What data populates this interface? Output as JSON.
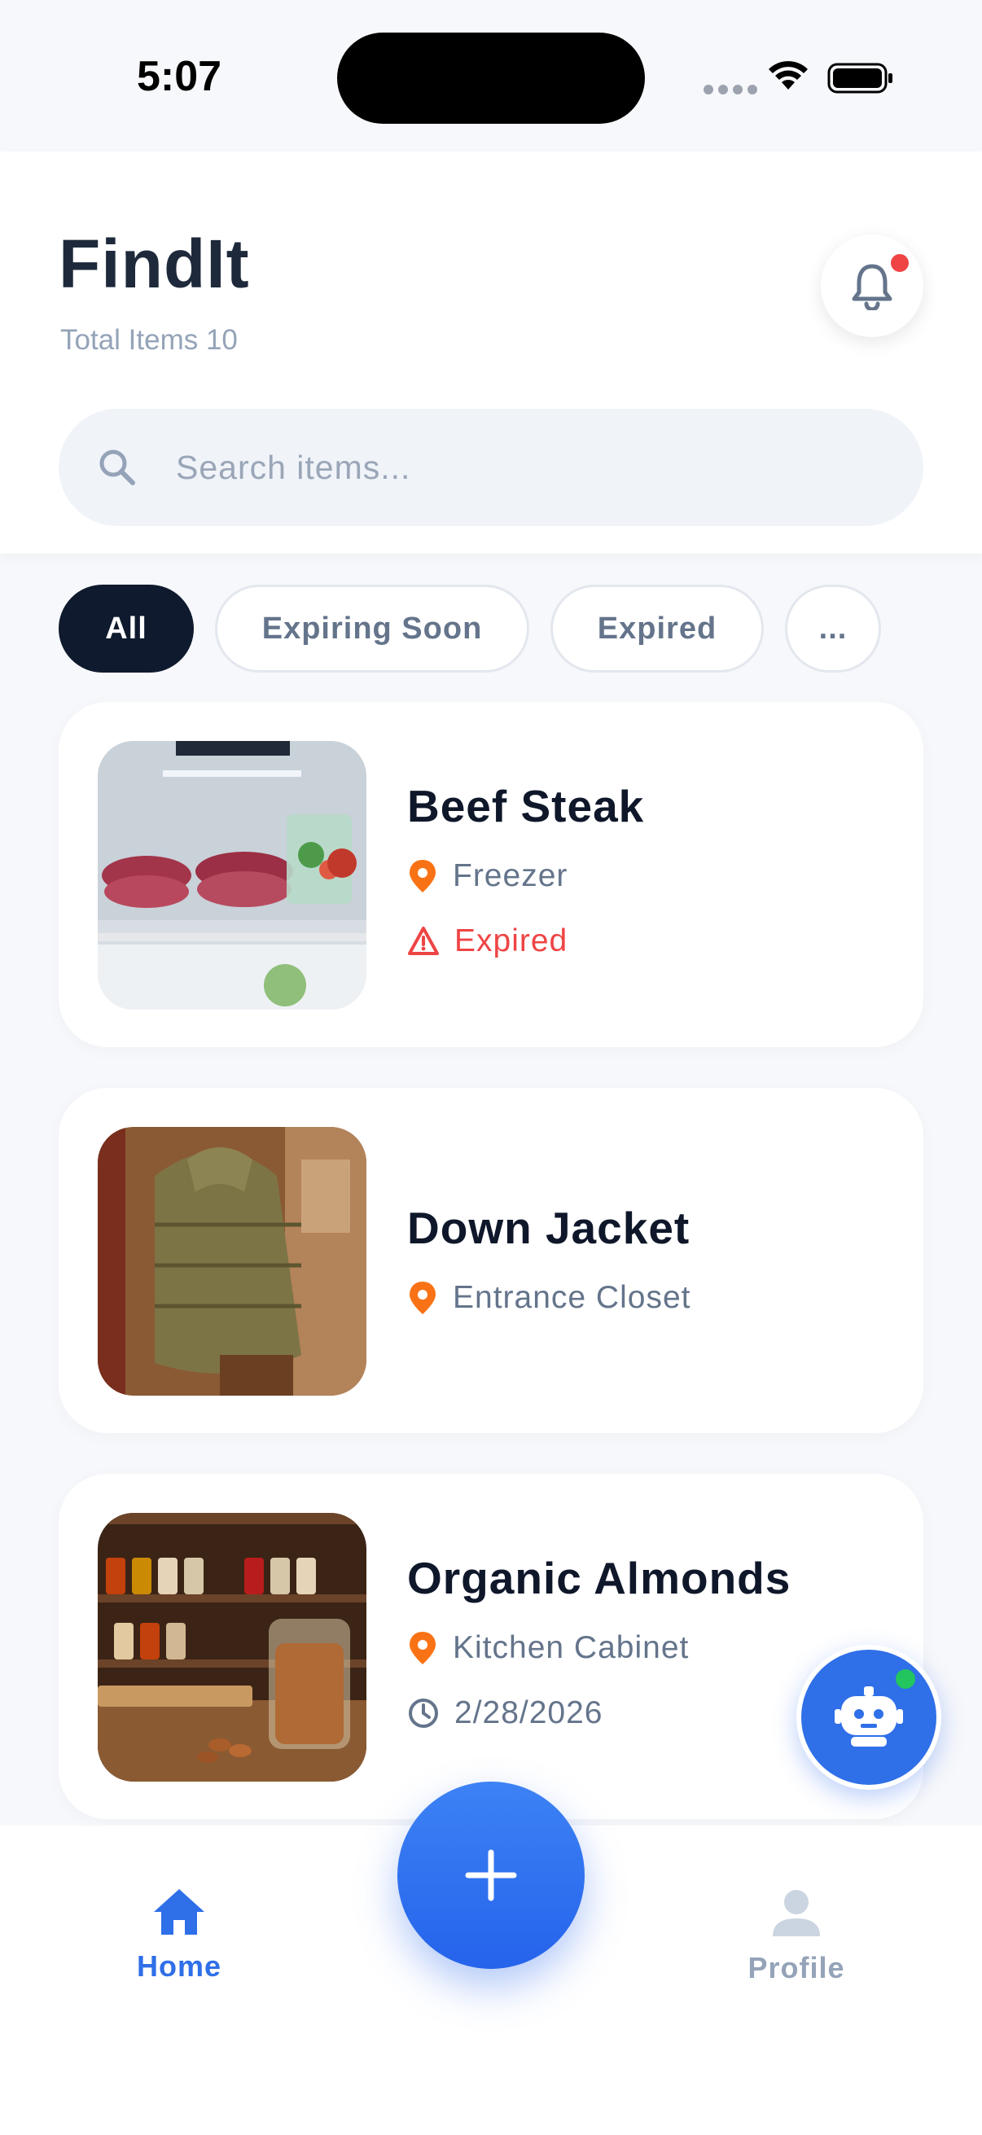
{
  "status_bar": {
    "time": "5:07"
  },
  "header": {
    "title": "FindIt",
    "subtitle": "Total Items 10"
  },
  "search": {
    "placeholder": "Search items...",
    "value": ""
  },
  "filters": [
    {
      "label": "All",
      "active": true
    },
    {
      "label": "Expiring Soon",
      "active": false
    },
    {
      "label": "Expired",
      "active": false
    },
    {
      "label": "...",
      "active": false
    }
  ],
  "items": [
    {
      "name": "Beef Steak",
      "location": "Freezer",
      "status": "Expired"
    },
    {
      "name": "Down Jacket",
      "location": "Entrance Closet"
    },
    {
      "name": "Organic Almonds",
      "location": "Kitchen Cabinet",
      "date": "2/28/2026"
    }
  ],
  "nav": {
    "home_label": "Home",
    "profile_label": "Profile"
  },
  "icons": {
    "bell": "bell-icon",
    "search": "search-icon",
    "location": "location-pin-icon",
    "warning": "warning-icon",
    "clock": "clock-icon",
    "add": "plus-icon",
    "assistant": "robot-icon",
    "home": "home-icon",
    "profile": "user-icon"
  },
  "colors": {
    "accent": "#2f6fe8",
    "danger": "#ef4444",
    "pin": "#f97316",
    "active_chip": "#0f1a2e",
    "online": "#22c55e"
  }
}
